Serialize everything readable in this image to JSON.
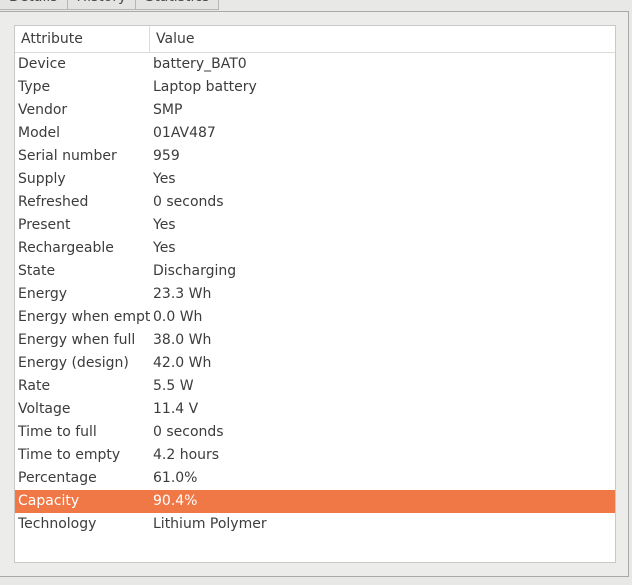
{
  "tabs": [
    "Details",
    "History",
    "Statistics"
  ],
  "table": {
    "headers": {
      "attribute": "Attribute",
      "value": "Value"
    },
    "rows": [
      {
        "attribute": "Device",
        "value": "battery_BAT0"
      },
      {
        "attribute": "Type",
        "value": "Laptop battery"
      },
      {
        "attribute": "Vendor",
        "value": "SMP"
      },
      {
        "attribute": "Model",
        "value": "01AV487"
      },
      {
        "attribute": "Serial number",
        "value": "959"
      },
      {
        "attribute": "Supply",
        "value": "Yes"
      },
      {
        "attribute": "Refreshed",
        "value": "0 seconds"
      },
      {
        "attribute": "Present",
        "value": "Yes"
      },
      {
        "attribute": "Rechargeable",
        "value": "Yes"
      },
      {
        "attribute": "State",
        "value": "Discharging"
      },
      {
        "attribute": "Energy",
        "value": "23.3 Wh"
      },
      {
        "attribute": "Energy when empty",
        "value": "0.0 Wh"
      },
      {
        "attribute": "Energy when full",
        "value": "38.0 Wh"
      },
      {
        "attribute": "Energy (design)",
        "value": "42.0 Wh"
      },
      {
        "attribute": "Rate",
        "value": "5.5 W"
      },
      {
        "attribute": "Voltage",
        "value": "11.4 V"
      },
      {
        "attribute": "Time to full",
        "value": "0 seconds"
      },
      {
        "attribute": "Time to empty",
        "value": "4.2 hours"
      },
      {
        "attribute": "Percentage",
        "value": "61.0%"
      },
      {
        "attribute": "Capacity",
        "value": "90.4%",
        "selected": true
      },
      {
        "attribute": "Technology",
        "value": "Lithium Polymer"
      }
    ]
  },
  "colors": {
    "selection": "#f07846",
    "window_bg": "#e8e8e7"
  }
}
